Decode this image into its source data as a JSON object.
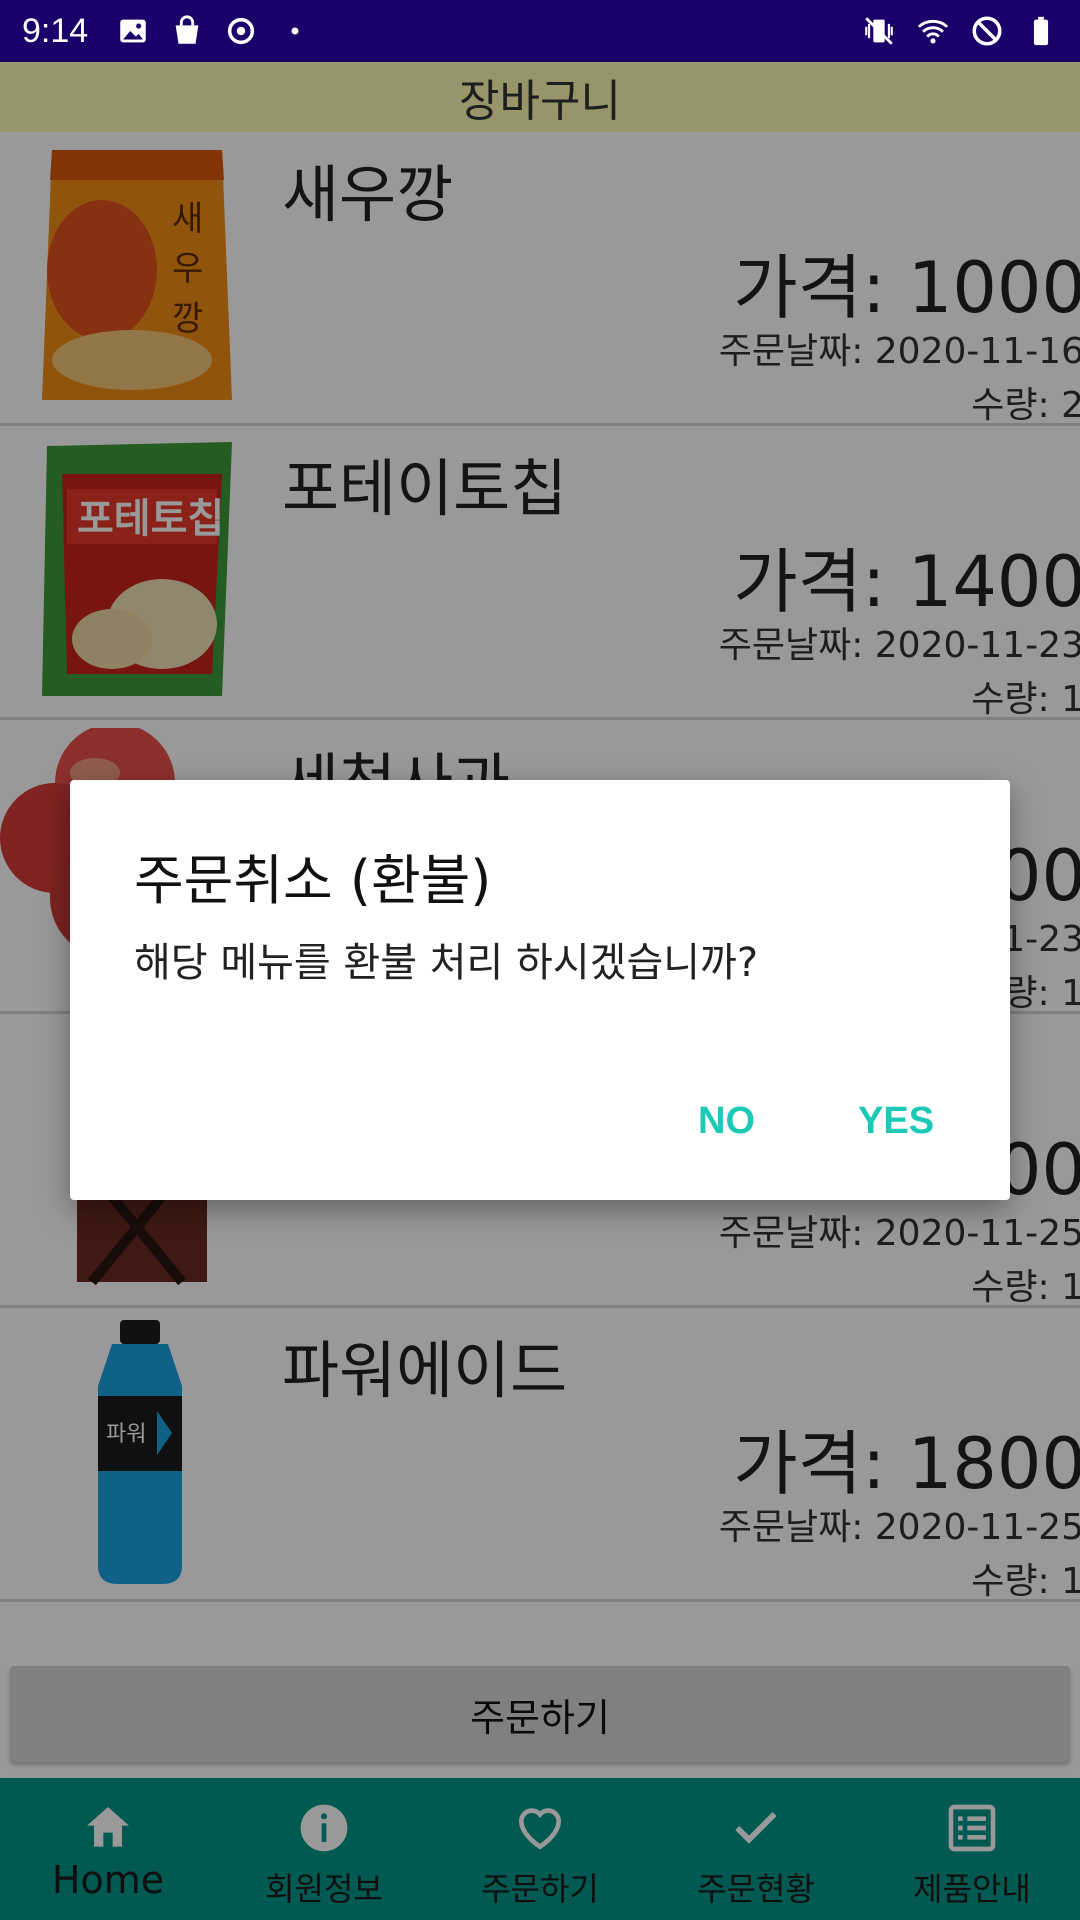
{
  "status_bar": {
    "time": "9:14",
    "icons": [
      "image-icon",
      "shopping-bag-icon",
      "sync-icon",
      "dot-icon",
      "vibrate-icon",
      "wifi-icon",
      "do-not-disturb-icon",
      "battery-icon"
    ]
  },
  "app": {
    "title": "장바구니"
  },
  "items": [
    {
      "name": "새우깡",
      "price": "가격: 1000",
      "date": "주문날짜: 2020-11-16",
      "qty": "수량: 2",
      "image": "snack-bag-orange"
    },
    {
      "name": "포테이토칩",
      "price": "가격: 1400",
      "date": "주문날짜: 2020-11-23",
      "qty": "수량: 1",
      "image": "snack-bag-green"
    },
    {
      "name": "세척사과",
      "price": "가격: 2000",
      "date": "주문날짜: 2020-11-23",
      "qty": "수량: 1",
      "image": "apples"
    },
    {
      "name": "",
      "price": "가격: 1500",
      "date": "주문날짜: 2020-11-25",
      "qty": "수량: 1",
      "image": "snack-box"
    },
    {
      "name": "파워에이드",
      "price": "가격: 1800",
      "date": "주문날짜: 2020-11-25",
      "qty": "수량: 1",
      "image": "sports-drink-bottle"
    }
  ],
  "order_button": "주문하기",
  "bottom_nav": [
    {
      "label": "Home",
      "icon": "home-icon",
      "active": true
    },
    {
      "label": "회원정보",
      "icon": "info-icon",
      "active": false
    },
    {
      "label": "주문하기",
      "icon": "heart-icon",
      "active": false
    },
    {
      "label": "주문현황",
      "icon": "check-icon",
      "active": false
    },
    {
      "label": "제품안내",
      "icon": "list-icon",
      "active": false
    }
  ],
  "dialog": {
    "title": "주문취소 (환불)",
    "message": "해당 메뉴를 환불 처리 하시겠습니까?",
    "no_label": "NO",
    "yes_label": "YES"
  },
  "colors": {
    "status_bar": "#1a0068",
    "title_bar": "#fdf8b2",
    "bottom_nav": "#009688",
    "dialog_button": "#1cc9b4"
  }
}
